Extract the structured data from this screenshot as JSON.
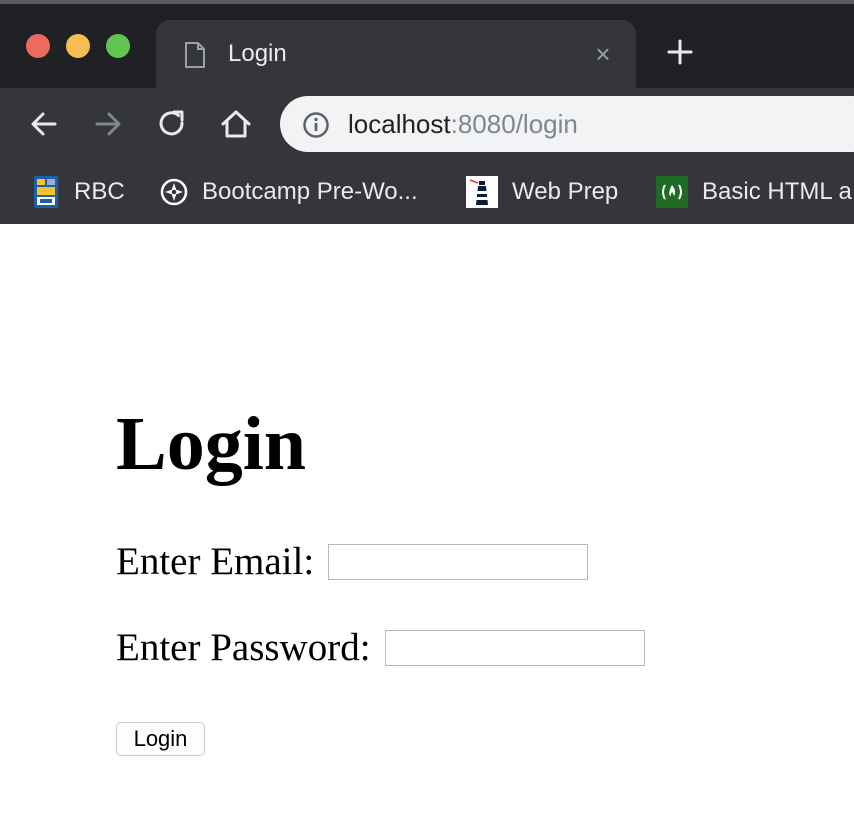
{
  "window": {
    "tab": {
      "title": "Login",
      "close_glyph": "×"
    }
  },
  "toolbar": {
    "url_host": "localhost",
    "url_rest": ":8080/login"
  },
  "bookmarks": [
    {
      "label": "RBC",
      "icon": "rbc-icon"
    },
    {
      "label": "Bootcamp Pre-Wo...",
      "icon": "compass-icon"
    },
    {
      "label": "Web Prep",
      "icon": "lighthouse-icon"
    },
    {
      "label": "Basic HTML a",
      "icon": "freecodecamp-icon"
    }
  ],
  "page": {
    "heading": "Login",
    "email_label": "Enter Email:",
    "email_value": "",
    "password_label": "Enter Password:",
    "password_value": "",
    "submit_label": "Login"
  },
  "colors": {
    "chrome_dark": "#202124",
    "chrome_toolbar": "#35363a",
    "omnibox": "#f1f3f4",
    "traffic_red": "#ed6a5e",
    "traffic_yellow": "#f5bf4f",
    "traffic_green": "#61c554"
  }
}
